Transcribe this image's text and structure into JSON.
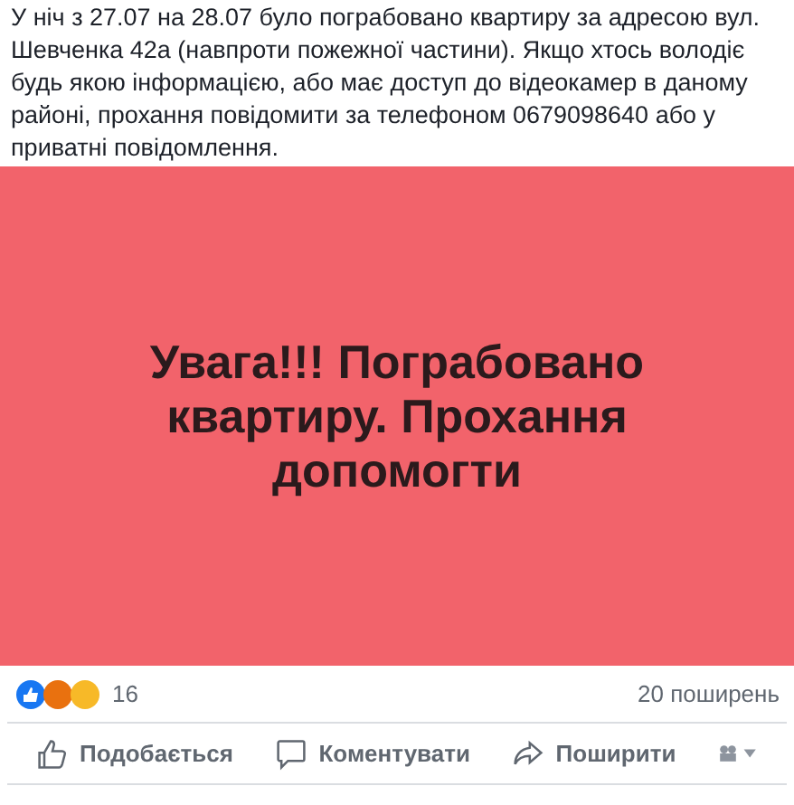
{
  "post": {
    "text": "У ніч з 27.07 на 28.07 було пограбовано квартиру за адресою вул. Шевченка 42а (навпроти пожежної частини). Якщо хтось володіє будь якою інформацією, або має доступ до відеокамер в даному районі, прохання повідомити за телефоном 0679098640 або у приватні повідомлення."
  },
  "banner": {
    "text": "Увага!!! Пограбовано квартиру. Прохання допомогти"
  },
  "reactions": {
    "count": "16",
    "shares": "20 поширень"
  },
  "actions": [
    {
      "kind": "like",
      "label": "Подобається"
    },
    {
      "kind": "comment",
      "label": "Коментувати"
    },
    {
      "kind": "share",
      "label": "Поширити"
    }
  ]
}
